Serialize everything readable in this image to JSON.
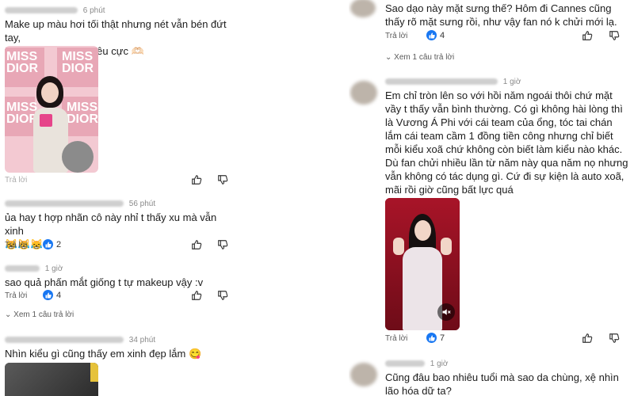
{
  "left": {
    "c1": {
      "time": "6 phút",
      "text": "Make up màu hơi tối thật nhưng nét vẫn bén đứt tay,\nfan service với fan yêu cực 🫶🏻",
      "reply": "Trả lời",
      "photo_text": [
        "MISS",
        "DIOR",
        "MISS",
        "DIOR",
        "MISS",
        "DIOR",
        "MISS",
        "DIOR"
      ]
    },
    "c2": {
      "time": "56 phút",
      "text": "ủa hay t hợp nhãn cô này nhỉ t thấy xu mà vẫn xinh\n😹😹😹",
      "reply": "Trả lời",
      "likes": "2"
    },
    "c3": {
      "time": "1 giờ",
      "text": "sao quả phấn mắt giống t tự makeup vậy :v",
      "reply": "Trả lời",
      "likes": "4",
      "view_more": "Xem 1 câu trả lời"
    },
    "c4": {
      "time": "34 phút",
      "text": "Nhìn kiểu gì cũng thấy em xinh đẹp lắm 😋"
    }
  },
  "right": {
    "r1": {
      "text": "Sao dạo này mặt sưng thế? Hôm đi Cannes cũng\nthấy rõ mặt sưng rồi, như vậy fan nó k chửi mới lạ.",
      "reply": "Trả lời",
      "likes": "4",
      "view_more": "Xem 1 câu trả lời"
    },
    "r2": {
      "time": "1 giờ",
      "text": "Em chỉ tròn lên so với hồi năm ngoái thôi chứ mặt\nvầy t thấy vẫn bình thường. Có gì không hài lòng thì\nlà Vương Á Phi với cái team của ổng, tóc tai chán\nlắm cái team cầm 1 đồng tiền công nhưng chỉ biết\nmỗi kiểu xoã chứ không còn biết làm kiểu nào khác.\nDù fan chửi nhiều lần từ năm này qua năm nọ nhưng\nvẫn không có tác dụng gì. Cứ đi sự kiện là auto xoã,\nmãi rồi giờ cũng bất lực quá",
      "reply": "Trả lời",
      "likes": "7"
    },
    "r3": {
      "time": "1 giờ",
      "text": "Cũng đâu bao nhiêu tuổi mà sao da chùng, xệ nhìn\nlão hóa dữ ta?"
    }
  },
  "colors": {
    "like_blue": "#1877f2",
    "text": "#1c1c1c",
    "meta": "#8a8a8a"
  }
}
